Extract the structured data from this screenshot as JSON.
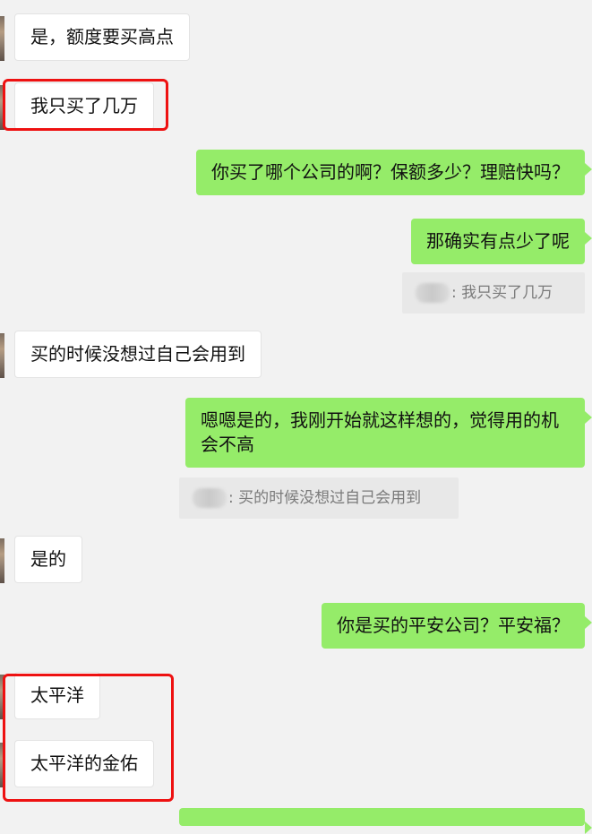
{
  "messages": [
    {
      "side": "left",
      "text": "是，额度要买高点"
    },
    {
      "side": "left",
      "text": "我只买了几万"
    },
    {
      "side": "right",
      "text": "你买了哪个公司的啊？保额多少？理赔快吗？"
    },
    {
      "side": "right",
      "text": "那确实有点少了呢",
      "quote": ": 我只买了几万"
    },
    {
      "side": "left",
      "text": "买的时候没想过自己会用到"
    },
    {
      "side": "right",
      "text": "嗯嗯是的，我刚开始就这样想的，觉得用的机会不高",
      "quote": ": 买的时候没想过自己会用到"
    },
    {
      "side": "left",
      "text": "是的"
    },
    {
      "side": "right",
      "text": "你是买的平安公司？平安福？"
    },
    {
      "side": "left",
      "text": "太平洋"
    },
    {
      "side": "left",
      "text": "太平洋的金佑"
    }
  ],
  "colors": {
    "background": "#f2f2f2",
    "incoming_bubble": "#ffffff",
    "outgoing_bubble": "#95ec69",
    "quote_block": "#e8e8e8",
    "highlight_box": "#ee1111"
  }
}
